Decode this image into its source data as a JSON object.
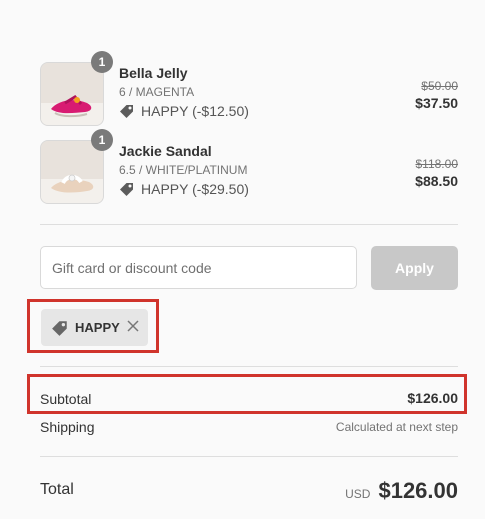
{
  "items": [
    {
      "quantity": "1",
      "name": "Bella Jelly",
      "variant": "6 / MAGENTA",
      "discount": "HAPPY (-$12.50)",
      "original_price": "$50.00",
      "price": "$37.50",
      "image": "magenta-jelly-sandal"
    },
    {
      "quantity": "1",
      "name": "Jackie Sandal",
      "variant": "6.5 / WHITE/PLATINUM",
      "discount": "HAPPY (-$29.50)",
      "original_price": "$118.00",
      "price": "$88.50",
      "image": "white-platinum-sandal"
    }
  ],
  "discount_form": {
    "placeholder": "Gift card or discount code",
    "value": "",
    "apply_label": "Apply"
  },
  "applied_code": {
    "label": "HAPPY"
  },
  "summary": {
    "subtotal_label": "Subtotal",
    "subtotal_value": "$126.00",
    "shipping_label": "Shipping",
    "shipping_value": "Calculated at next step",
    "total_label": "Total",
    "currency": "USD",
    "total_value": "$126.00"
  },
  "colors": {
    "highlight": "#d0342c",
    "apply_disabled": "#c8c8c8",
    "badge": "#7a7a7a"
  }
}
